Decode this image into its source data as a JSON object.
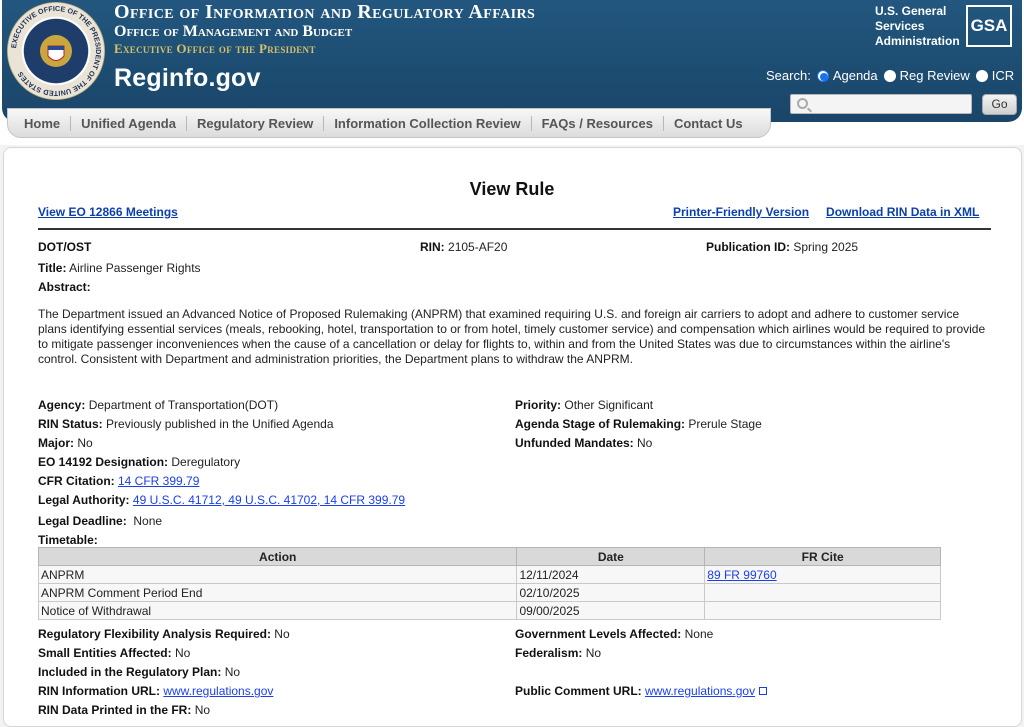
{
  "header": {
    "office_line": "Office of Information and Regulatory Affairs",
    "omb_line": "Office of Management and Budget",
    "eop_line": "Executive Office of the President",
    "site_name": "Reginfo.gov",
    "seal_text": "EXECUTIVE OFFICE OF THE PRESIDENT OF THE UNITED STATES",
    "gsa_text": [
      "U.S. General",
      "Services",
      "Administration"
    ],
    "gsa_logo": "GSA",
    "search_label": "Search:",
    "search_options": [
      "Agenda",
      "Reg Review",
      "ICR"
    ],
    "search_selected": "Agenda",
    "search_placeholder": "",
    "go_label": "Go"
  },
  "nav": [
    "Home",
    "Unified Agenda",
    "Regulatory Review",
    "Information Collection Review",
    "FAQs / Resources",
    "Contact Us"
  ],
  "page": {
    "title": "View Rule",
    "link_meetings": "View EO 12866 Meetings",
    "link_printer": "Printer-Friendly Version",
    "link_xml": "Download RIN Data in XML"
  },
  "rule": {
    "agency_code": "DOT/OST",
    "rin_label": "RIN:",
    "rin": "2105-AF20",
    "pubid_label": "Publication ID:",
    "pubid": "Spring 2025",
    "title_label": "Title:",
    "title": "Airline Passenger Rights",
    "abstract_label": "Abstract:",
    "abstract": "The Department issued an Advanced Notice of Proposed Rulemaking (ANPRM) that examined requiring U.S. and foreign air carriers to adopt and adhere to customer service plans identifying essential services (meals, rebooking, hotel, transportation to or from hotel, timely customer service) and compensation which airlines would be required to provide to mitigate passenger inconveniences when the cause of a cancellation or delay for flights to, within and from the United States was due to circumstances within the airline's control.  Consistent with Department and administration priorities, the Department plans to withdraw the ANPRM."
  },
  "fields_left": [
    {
      "label": "Agency:",
      "value": "Department of Transportation(DOT)"
    },
    {
      "label": "RIN Status:",
      "value": "Previously published in the Unified Agenda"
    },
    {
      "label": "Major:",
      "value": "No"
    },
    {
      "label": "EO 14192 Designation:",
      "value": "Deregulatory"
    },
    {
      "label": "CFR Citation:",
      "value": "14 CFR 399.79"
    },
    {
      "label": "Legal Authority:",
      "value": "49 U.S.C. 41712, 49 U.S.C. 41702, 14 CFR 399.79"
    },
    {
      "label": "Legal Deadline:",
      "value": "None"
    },
    {
      "label": "Timetable:",
      "value": ""
    }
  ],
  "fields_right": [
    {
      "label": "Priority:",
      "value": "Other Significant"
    },
    {
      "label": "Agenda Stage of Rulemaking:",
      "value": "Prerule Stage"
    },
    {
      "label": "Unfunded Mandates:",
      "value": "No"
    }
  ],
  "timetable": {
    "headers": [
      "Action",
      "Date",
      "FR Cite"
    ],
    "rows": [
      [
        "ANPRM",
        "12/11/2024",
        "89 FR 99760"
      ],
      [
        "ANPRM Comment Period End",
        "02/10/2025",
        ""
      ],
      [
        "Notice of Withdrawal",
        "09/00/2025",
        ""
      ]
    ]
  },
  "bottom_left": [
    {
      "label": "Regulatory Flexibility Analysis Required:",
      "value": "No"
    },
    {
      "label": "Small Entities Affected:",
      "value": "No"
    },
    {
      "label": "Included in the Regulatory Plan:",
      "value": "No"
    },
    {
      "label": "RIN Information URL:",
      "value": "www.regulations.gov"
    },
    {
      "label": "RIN Data Printed in the FR:",
      "value": "No"
    }
  ],
  "bottom_right": [
    {
      "label": "Government Levels Affected:",
      "value": "None"
    },
    {
      "label": "Federalism:",
      "value": "No"
    },
    {
      "label": "Public Comment URL:",
      "value": "www.regulations.gov"
    }
  ]
}
